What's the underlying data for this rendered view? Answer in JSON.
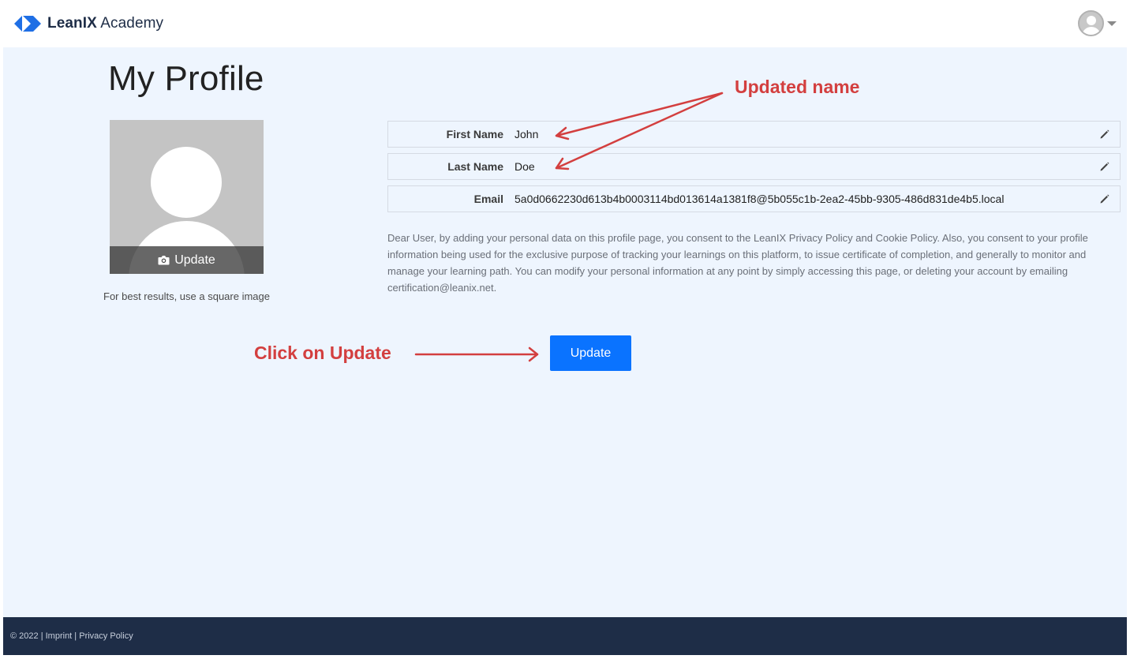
{
  "header": {
    "brand_bold": "LeanIX",
    "brand_light": "Academy"
  },
  "page": {
    "title": "My Profile"
  },
  "photo": {
    "update_label": "Update",
    "hint": "For best results, use a square image"
  },
  "fields": [
    {
      "label": "First Name",
      "value": "John"
    },
    {
      "label": "Last Name",
      "value": "Doe"
    },
    {
      "label": "Email",
      "value": "5a0d0662230d613b4b0003114bd013614a1381f8@5b055c1b-2ea2-45bb-9305-486d831de4b5.local"
    }
  ],
  "consent_text": "Dear User, by adding your personal data on this profile page, you consent to the LeanIX Privacy Policy and Cookie Policy. Also, you consent to your profile information being used for the exclusive purpose of tracking your learnings on this platform, to issue certificate of completion, and generally to monitor and manage your learning path. You can modify your personal information at any point by simply accessing this page, or deleting your account by emailing certification@leanix.net.",
  "update_button": "Update",
  "annotations": {
    "updated_name": "Updated name",
    "click_update": "Click on Update",
    "color": "#d33f3f"
  },
  "footer": {
    "copyright": "© 2022",
    "sep1": " | ",
    "imprint": "Imprint",
    "sep2": " | ",
    "privacy": "Privacy Policy"
  },
  "colors": {
    "accent": "#0a73ff",
    "page_bg": "#eef5fe",
    "footer_bg": "#1e2d47"
  }
}
